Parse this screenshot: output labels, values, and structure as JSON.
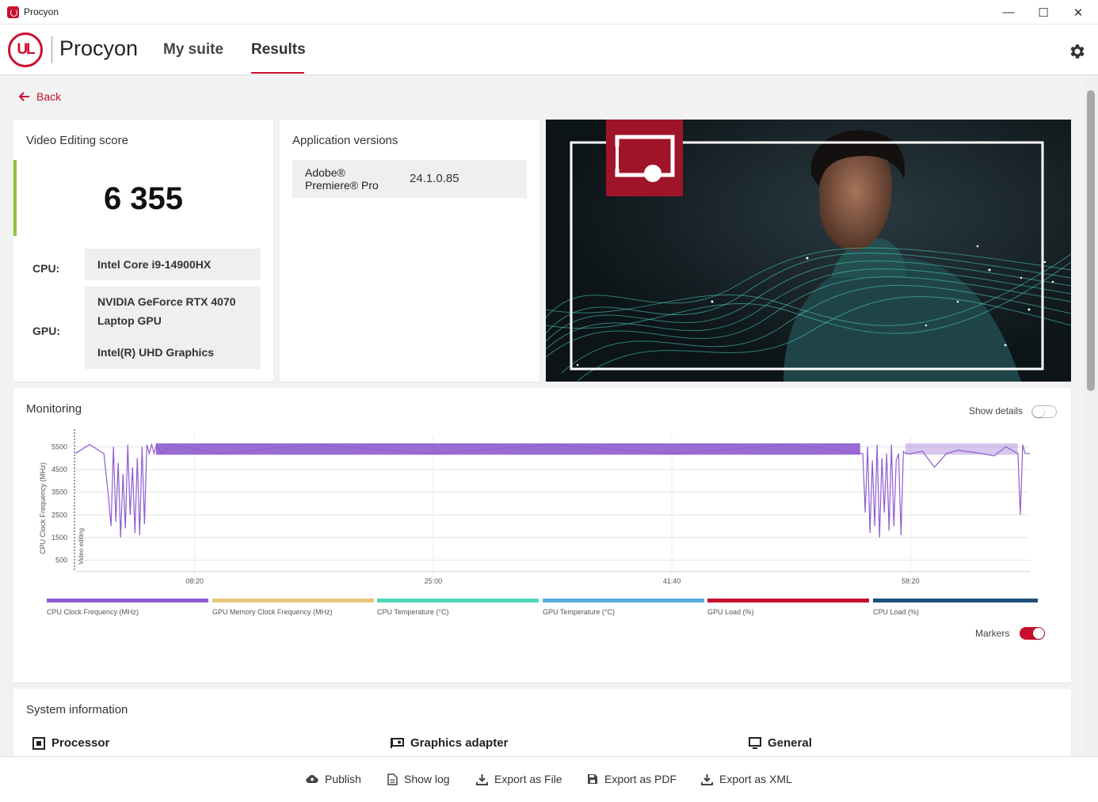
{
  "window": {
    "title": "Procyon",
    "minimize_glyph": "—",
    "maximize_glyph": "☐",
    "close_glyph": "✕"
  },
  "header": {
    "logo_text": "UL",
    "brand": "Procyon",
    "nav": [
      {
        "label": "My suite",
        "active": false
      },
      {
        "label": "Results",
        "active": true
      }
    ],
    "settings_icon": "gear-icon"
  },
  "back": {
    "label": "Back"
  },
  "score_card": {
    "title": "Video Editing score",
    "score": "6 355",
    "cpu_label": "CPU:",
    "cpu_value": "Intel Core i9-14900HX",
    "gpu_label": "GPU:",
    "gpu_values": [
      "NVIDIA GeForce RTX 4070",
      "Laptop GPU",
      "Intel(R) UHD Graphics"
    ]
  },
  "versions_card": {
    "title": "Application versions",
    "rows": [
      {
        "name": "Adobe® Premiere® Pro",
        "version": "24.1.0.85"
      }
    ]
  },
  "monitoring": {
    "title": "Monitoring",
    "show_details_label": "Show details",
    "show_details_on": false,
    "markers_label": "Markers",
    "markers_on": true,
    "marker_label": "Video editing",
    "legend": [
      {
        "label": "CPU Clock Frequency (MHz)",
        "color": "#8e5ccf"
      },
      {
        "label": "GPU Memory Clock Frequency (MHz)",
        "color": "#e8c57a"
      },
      {
        "label": "CPU Temperature (°C)",
        "color": "#4fd6b8"
      },
      {
        "label": "GPU Temperature (°C)",
        "color": "#5aaee0"
      },
      {
        "label": "GPU Load (%)",
        "color": "#c8102e"
      },
      {
        "label": "CPU Load (%)",
        "color": "#1e4f7a"
      }
    ]
  },
  "chart_data": {
    "type": "line",
    "title": "",
    "ylabel": "CPU Clock Frequency (MHz)",
    "xlabel": "",
    "y_ticks": [
      500,
      1500,
      2500,
      3500,
      4500,
      5500
    ],
    "x_ticks": [
      "08:20",
      "25:00",
      "41:40",
      "58:20"
    ],
    "xlim_seconds": [
      0,
      4000
    ],
    "ylim": [
      0,
      6000
    ],
    "series": [
      {
        "name": "CPU Clock Frequency (MHz)",
        "color": "#8e5ccf",
        "x_seconds": [
          0,
          60,
          120,
          140,
          150,
          160,
          170,
          180,
          190,
          200,
          210,
          220,
          230,
          240,
          250,
          260,
          270,
          280,
          290,
          300,
          310,
          320,
          330,
          340,
          360,
          400,
          600,
          1000,
          1500,
          2000,
          2500,
          3000,
          3300,
          3310,
          3320,
          3330,
          3340,
          3350,
          3360,
          3370,
          3380,
          3390,
          3400,
          3410,
          3420,
          3430,
          3440,
          3450,
          3460,
          3470,
          3480,
          3500,
          3550,
          3600,
          3650,
          3700,
          3800,
          3850,
          3900,
          3950,
          3960,
          3970,
          3980,
          4000
        ],
        "values": [
          5200,
          5600,
          5200,
          3200,
          2000,
          5500,
          2200,
          4800,
          1500,
          4300,
          1900,
          5600,
          2500,
          4600,
          1700,
          5000,
          1600,
          5500,
          2100,
          5600,
          5200,
          5600,
          5200,
          5600,
          5200,
          5600,
          5200,
          5600,
          5200,
          5600,
          5200,
          5600,
          5200,
          2600,
          5500,
          1700,
          4900,
          2000,
          5600,
          1500,
          5000,
          2600,
          5200,
          1800,
          5600,
          2000,
          4900,
          5200,
          1600,
          5300,
          5200,
          5200,
          5300,
          4600,
          5200,
          5350,
          5200,
          5100,
          5500,
          5200,
          2500,
          5600,
          5200,
          5200
        ]
      }
    ]
  },
  "system_info": {
    "title": "System information",
    "sections": [
      {
        "label": "Processor",
        "icon": "processor-icon"
      },
      {
        "label": "Graphics adapter",
        "icon": "graphics-card-icon"
      },
      {
        "label": "General",
        "icon": "monitor-icon"
      }
    ]
  },
  "actions": [
    {
      "label": "Publish",
      "icon": "cloud-upload-icon"
    },
    {
      "label": "Show log",
      "icon": "document-icon"
    },
    {
      "label": "Export as File",
      "icon": "download-icon"
    },
    {
      "label": "Export as PDF",
      "icon": "save-icon"
    },
    {
      "label": "Export as XML",
      "icon": "download-icon"
    }
  ]
}
